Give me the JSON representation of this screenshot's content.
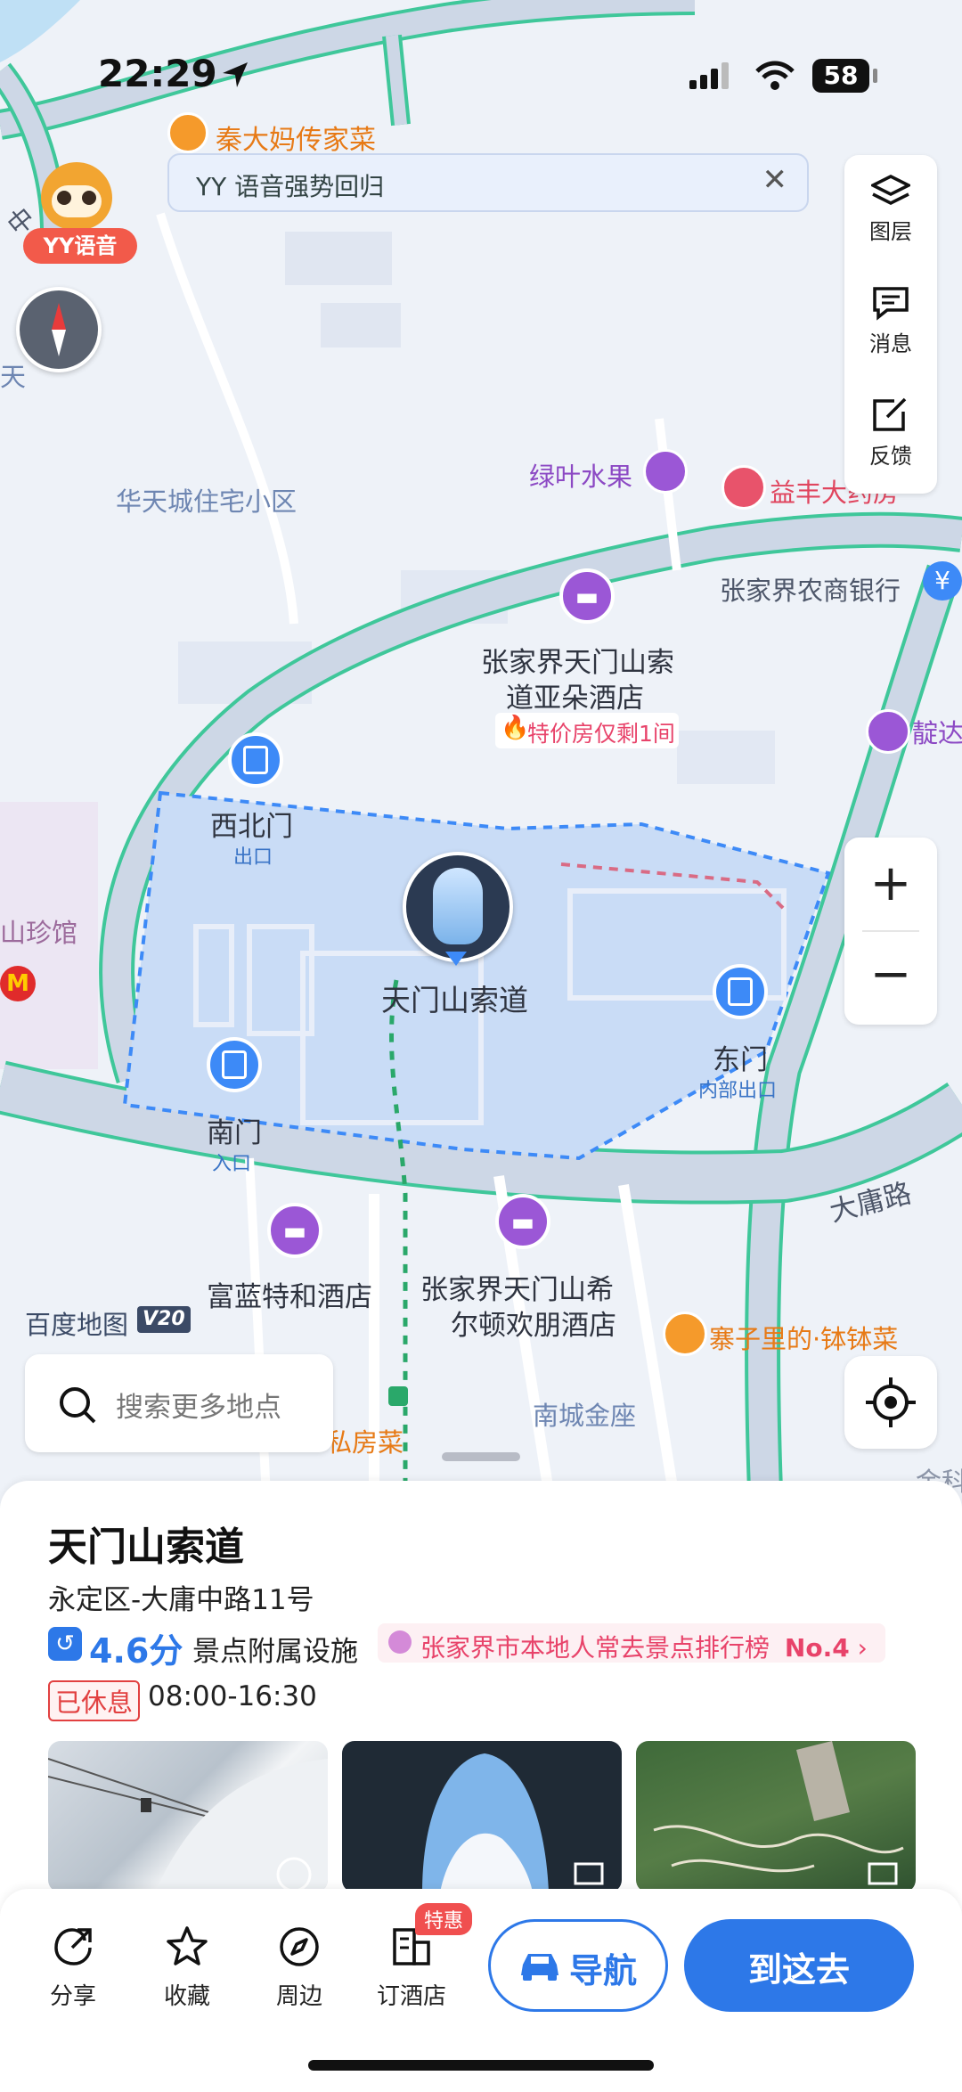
{
  "status": {
    "time": "22:29",
    "battery": "58"
  },
  "banner": {
    "text": "YY 语音强势回归",
    "close": "✕"
  },
  "yy_badge": {
    "label": "YY语音"
  },
  "toolbar": {
    "layers_label": "图层",
    "messages_label": "消息",
    "feedback_label": "反馈"
  },
  "map": {
    "labels": {
      "qin_dama": "秦大妈传家菜",
      "huatian": "华天城住宅小区",
      "lvye": "绿叶水果",
      "yifeng": "益丰大药房",
      "nongshang": "张家界农商银行",
      "hotel1_line1": "张家界天门山索",
      "hotel1_line2": "道亚朵酒店",
      "hotel1_promo": "特价房仅剩1间",
      "xibeimen": "西北门",
      "xibeimen_sub": "出口",
      "tianmen": "天门山索道",
      "dongmen": "东门",
      "dongmen_sub": "内部出口",
      "nanmen": "南门",
      "nanmen_sub": "入口",
      "daxiong": "大庸路",
      "fulante": "富蓝特和酒店",
      "hilton_line1": "张家界天门山希",
      "hilton_line2": "尔顿欢朋酒店",
      "zhaizi": "寨子里的·钵钵菜",
      "baidu": "百度地图",
      "baidu_ver": "V20",
      "nancheng": "南城金座",
      "sifang": "私房菜",
      "shanzhen": "山珍馆",
      "tian_edge": "天",
      "zhong": "中",
      "long": "靛达",
      "jinke": "金科"
    }
  },
  "zoom": {
    "plus": "+",
    "minus": "−"
  },
  "search": {
    "placeholder": "搜索更多地点"
  },
  "place": {
    "name": "天门山索道",
    "address": "永定区-大庸中路11号",
    "rating": "4.6分",
    "category": "景点附属设施",
    "rank_text": "张家界市本地人常去景点排行榜",
    "rank_no": "No.4",
    "status": "已休息",
    "hours": "08:00-16:30"
  },
  "bottom": {
    "share": "分享",
    "collect": "收藏",
    "nearby": "周边",
    "hotel": "订酒店",
    "hotel_badge": "特惠",
    "navigate": "导航",
    "go": "到这去"
  },
  "colors": {
    "accent": "#2d78e8",
    "road_outline": "#3fc79a",
    "area_fill": "#c9dcf6"
  }
}
